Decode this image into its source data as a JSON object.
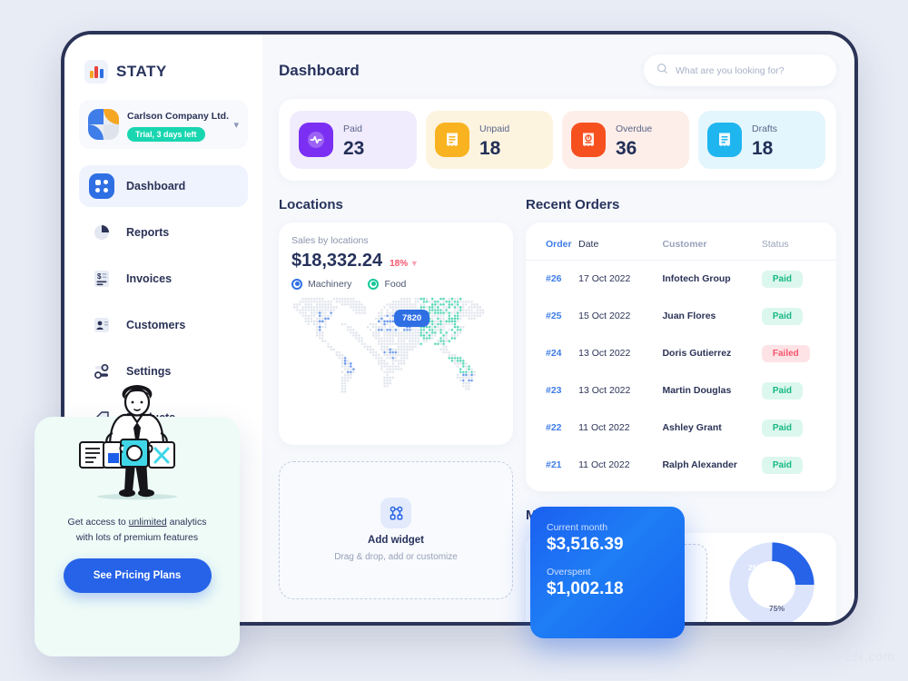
{
  "brand": {
    "name": "STATY",
    "logo_icon": "bar-chart-logo-icon"
  },
  "org": {
    "name": "Carlson Company Ltd.",
    "badge": "Trial, 3 days left",
    "chevron_icon": "chevron-down-icon"
  },
  "sidebar": {
    "items": [
      {
        "label": "Dashboard",
        "icon": "grid-dashboard-icon",
        "active": true
      },
      {
        "label": "Reports",
        "icon": "pie-chart-icon",
        "active": false
      },
      {
        "label": "Invoices",
        "icon": "invoice-dollar-icon",
        "active": false
      },
      {
        "label": "Customers",
        "icon": "user-card-icon",
        "active": false
      },
      {
        "label": "Settings",
        "icon": "sliders-icon",
        "active": false
      },
      {
        "label": "Products",
        "icon": "tag-icon",
        "active": false
      }
    ]
  },
  "header": {
    "title": "Dashboard",
    "search": {
      "placeholder": "What are you looking for?",
      "value": "",
      "icon": "search-icon"
    }
  },
  "stats": [
    {
      "label": "Paid",
      "value": "23",
      "icon": "activity-pulse-icon",
      "icon_bg": "#7b2ff2",
      "card_bg": "#f1ecfd"
    },
    {
      "label": "Unpaid",
      "value": "18",
      "icon": "receipt-icon",
      "icon_bg": "#f9b320",
      "card_bg": "#fdf4e0"
    },
    {
      "label": "Overdue",
      "value": "36",
      "icon": "receipt-alert-icon",
      "icon_bg": "#f6501f",
      "card_bg": "#fdeee9"
    },
    {
      "label": "Drafts",
      "value": "18",
      "icon": "receipt-draft-icon",
      "icon_bg": "#1fb6f0",
      "card_bg": "#e4f6fd"
    }
  ],
  "locations": {
    "title": "Locations",
    "subtitle": "Sales by locations",
    "amount": "$18,332.24",
    "delta": "18%",
    "delta_icon": "down-arrow-icon",
    "legend": [
      {
        "label": "Machinery",
        "color": "#2f6fe4"
      },
      {
        "label": "Food",
        "color": "#16c79a"
      }
    ],
    "map_tooltip": "7820"
  },
  "orders": {
    "title": "Recent Orders",
    "columns": [
      "Order",
      "Date",
      "Customer",
      "Status"
    ],
    "rows": [
      {
        "order": "#26",
        "date": "17 Oct 2022",
        "customer": "Infotech Group",
        "status": "Paid"
      },
      {
        "order": "#25",
        "date": "15 Oct 2022",
        "customer": "Juan Flores",
        "status": "Paid"
      },
      {
        "order": "#24",
        "date": "13 Oct 2022",
        "customer": "Doris Gutierrez",
        "status": "Failed"
      },
      {
        "order": "#23",
        "date": "13 Oct 2022",
        "customer": "Martin Douglas",
        "status": "Paid"
      },
      {
        "order": "#22",
        "date": "11 Oct 2022",
        "customer": "Ashley Grant",
        "status": "Paid"
      },
      {
        "order": "#21",
        "date": "11 Oct 2022",
        "customer": "Ralph Alexander",
        "status": "Paid"
      }
    ]
  },
  "add_widget": {
    "icon": "widget-nodes-icon",
    "title": "Add widget",
    "subtitle": "Drag & drop, add or customize"
  },
  "expenses": {
    "title": "Monthly Expenses",
    "current_month_label": "Current month",
    "current_month_value": "$3,516.39",
    "overspent_label": "Overspent",
    "overspent_value": "$1,002.18"
  },
  "promo": {
    "text_before": "Get access to ",
    "link": "unlimited",
    "text_after": " analytics",
    "text_line2": "with lots of premium features",
    "button": "See Pricing Plans",
    "illustration": "person-holding-documents-illustration"
  },
  "watermark": {
    "text": "TOOOPEN.com",
    "icon": "cloud-icon"
  },
  "chart_data": {
    "type": "pie",
    "title": "Monthly Expenses",
    "labels": [
      "25%",
      "75%"
    ],
    "values": [
      25,
      75
    ],
    "colors": [
      "#2663e8",
      "#dbe4fb"
    ],
    "legend": "inline-labels"
  }
}
